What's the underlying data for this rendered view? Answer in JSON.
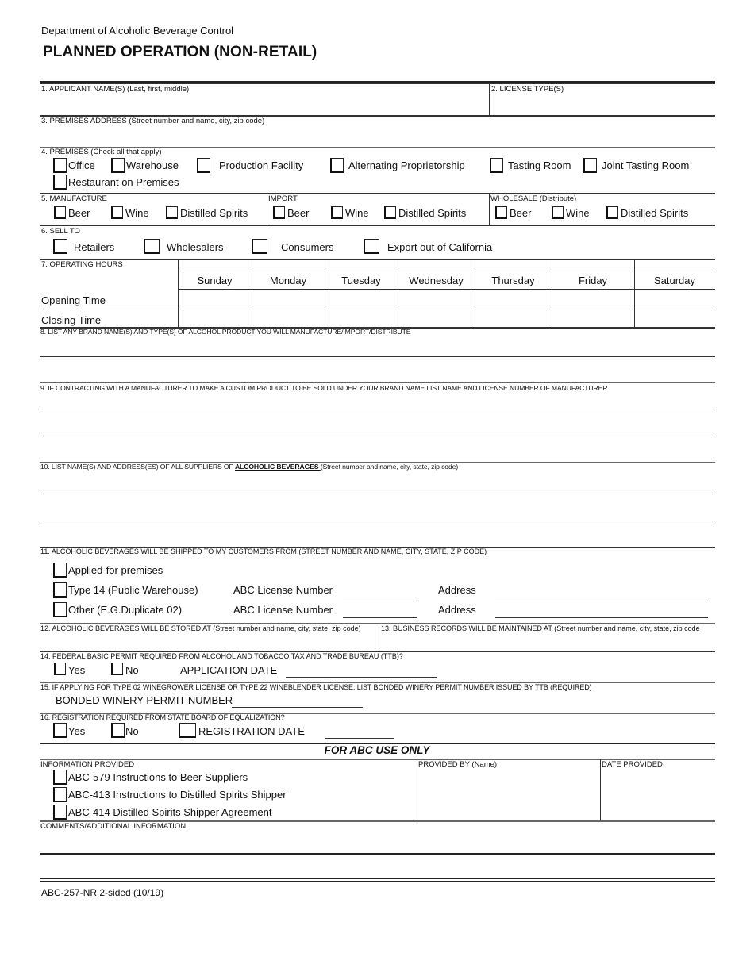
{
  "header": {
    "department": "Department of Alcoholic Beverage Control",
    "title": "PLANNED OPERATION (NON-RETAIL)"
  },
  "q1": {
    "label": "1.  APPLICANT NAME(S) (Last, first, middle)",
    "value": ""
  },
  "q2": {
    "label": "2.  LICENSE TYPE(S)",
    "value": ""
  },
  "q3": {
    "label": "3.  PREMISES ADDRESS (Street number and name, city, zip code)",
    "value": ""
  },
  "q4": {
    "label": "4.  PREMISES (Check all that apply)",
    "options": [
      {
        "label": "Office",
        "checked": false
      },
      {
        "label": "Warehouse",
        "checked": false
      },
      {
        "label": "Production Facility",
        "checked": false
      },
      {
        "label": "Alternating Proprietorship",
        "checked": false
      },
      {
        "label": "Tasting Room",
        "checked": false
      },
      {
        "label": "Joint Tasting Room",
        "checked": false
      },
      {
        "label": "Restaurant on Premises",
        "checked": false
      }
    ]
  },
  "q5": {
    "label": "5.  MANUFACTURE",
    "manufacture": [
      {
        "label": "Beer",
        "checked": false
      },
      {
        "label": "Wine",
        "checked": false
      },
      {
        "label": "Distilled Spirits",
        "checked": false
      }
    ],
    "import_label": "IMPORT",
    "import": [
      {
        "label": "Beer",
        "checked": false
      },
      {
        "label": "Wine",
        "checked": false
      },
      {
        "label": "Distilled Spirits",
        "checked": false
      }
    ],
    "wholesale_label": "WHOLESALE (Distribute)",
    "wholesale": [
      {
        "label": "Beer",
        "checked": false
      },
      {
        "label": "Wine",
        "checked": false
      },
      {
        "label": "Distilled Spirits",
        "checked": false
      }
    ]
  },
  "q6": {
    "label": "6.  SELL TO",
    "options": [
      {
        "label": "Retailers",
        "checked": false
      },
      {
        "label": "Wholesalers",
        "checked": false
      },
      {
        "label": "Consumers",
        "checked": false
      },
      {
        "label": "Export out of California",
        "checked": false
      }
    ]
  },
  "q7": {
    "label": "7.  OPERATING HOURS",
    "days": [
      "Sunday",
      "Monday",
      "Tuesday",
      "Wednesday",
      "Thursday",
      "Friday",
      "Saturday"
    ],
    "rows": [
      {
        "label": "Opening Time",
        "values": [
          "",
          "",
          "",
          "",
          "",
          "",
          ""
        ]
      },
      {
        "label": "Closing Time",
        "values": [
          "",
          "",
          "",
          "",
          "",
          "",
          ""
        ]
      }
    ]
  },
  "q8": {
    "label": "8. LIST ANY BRAND NAME(S) AND TYPE(S) OF ALCOHOL PRODUCT YOU WILL MANUFACTURE/IMPORT/DISTRIBUTE",
    "lines": [
      "",
      ""
    ]
  },
  "q9": {
    "label": "9. IF CONTRACTING WITH A MANUFACTURER TO MAKE A CUSTOM PRODUCT TO BE SOLD UNDER YOUR BRAND NAME LIST NAME AND LICENSE NUMBER OF MANUFACTURER.",
    "lines": [
      "",
      "",
      ""
    ]
  },
  "q10": {
    "label_prefix": "10.  LIST NAME(S) AND ADDRESS(ES) OF ALL SUPPLIERS OF ",
    "label_emphasis": "ALCOHOLIC BEVERAGES ",
    "label_suffix": "(Street number and name, city, state, zip code)",
    "lines": [
      "",
      "",
      ""
    ]
  },
  "q11": {
    "label": "11. ALCOHOLIC BEVERAGES WILL BE SHIPPED TO MY CUSTOMERS FROM (STREET NUMBER AND NAME, CITY, STATE, ZIP CODE)",
    "options": [
      {
        "label": "Applied-for premises",
        "checked": false
      },
      {
        "label": "Type 14 (Public Warehouse)",
        "checked": false,
        "license_label": "ABC License Number",
        "license_value": "",
        "address_label": "Address",
        "address_value": ""
      },
      {
        "label": "Other (E.G.Duplicate 02)",
        "checked": false,
        "license_label": "ABC License Number",
        "license_value": "",
        "address_label": "Address",
        "address_value": ""
      }
    ]
  },
  "q12": {
    "label": "12.  ALCOHOLIC BEVERAGES WILL BE STORED AT (Street number and name, city, state, zip code)",
    "value": ""
  },
  "q13": {
    "label": "13.  BUSINESS RECORDS WILL BE MAINTAINED AT (Street number and name, city, state, zip code",
    "value": ""
  },
  "q14": {
    "label": "14. FEDERAL BASIC PERMIT REQUIRED FROM ALCOHOL AND TOBACCO TAX AND TRADE BUREAU (TTB)?",
    "yes": "Yes",
    "no": "No",
    "date_label": "APPLICATION DATE",
    "date_value": ""
  },
  "q15": {
    "label": "15. IF APPLYING FOR TYPE 02 WINEGROWER LICENSE OR TYPE 22 WINEBLENDER LICENSE, LIST BONDED WINERY PERMIT NUMBER ISSUED BY TTB (REQUIRED)",
    "field_label": "BONDED WINERY PERMIT NUMBER",
    "field_value": ""
  },
  "q16": {
    "label": "16.  REGISTRATION REQUIRED FROM STATE BOARD OF EQUALIZATION?",
    "yes": "Yes",
    "no": "No",
    "date_label": "REGISTRATION DATE",
    "date_value": ""
  },
  "abc_use": {
    "title": "FOR ABC USE ONLY",
    "info_label": "INFORMATION PROVIDED",
    "info_items": [
      {
        "label": "ABC-579 Instructions to Beer Suppliers",
        "checked": false
      },
      {
        "label": "ABC-413 Instructions to Distilled Spirits Shipper",
        "checked": false
      },
      {
        "label": "ABC-414 Distilled Spirits Shipper Agreement",
        "checked": false
      }
    ],
    "provided_by_label": "PROVIDED BY (Name)",
    "provided_by_value": "",
    "date_provided_label": "DATE PROVIDED",
    "date_provided_value": "",
    "comments_label": "COMMENTS/ADDITIONAL INFORMATION",
    "comments_value": ""
  },
  "footer": {
    "form_id": "ABC-257-NR 2-sided (10/19)"
  }
}
